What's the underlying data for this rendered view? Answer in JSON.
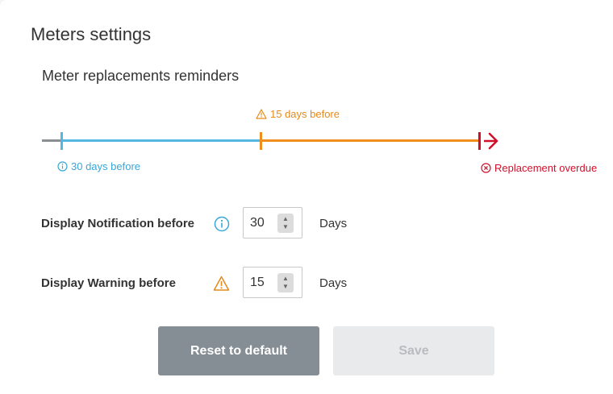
{
  "page_title": "Meters settings",
  "section_title": "Meter replacements reminders",
  "timeline": {
    "notification_label": "30 days before",
    "warning_label": "15 days before",
    "overdue_label": "Replacement overdue",
    "colors": {
      "notification": "#55b6e0",
      "warning": "#ef8e1c",
      "overdue": "#d0102b",
      "base": "#8a8f94"
    }
  },
  "notification_row": {
    "label": "Display Notification before",
    "icon": "info-icon",
    "value": "30",
    "unit": "Days"
  },
  "warning_row": {
    "label": "Display Warning before",
    "icon": "warning-icon",
    "value": "15",
    "unit": "Days"
  },
  "buttons": {
    "reset_label": "Reset to default",
    "save_label": "Save"
  }
}
